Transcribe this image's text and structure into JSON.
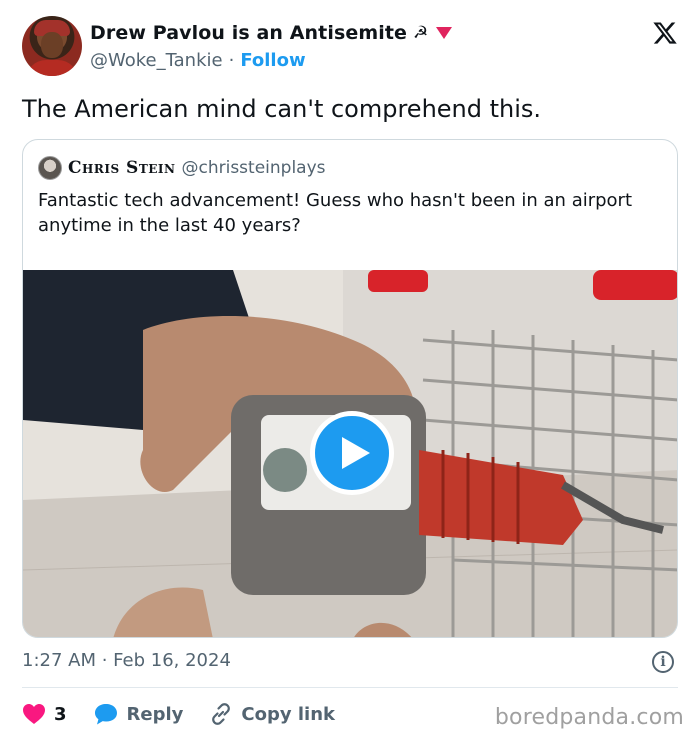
{
  "author": {
    "display_name": "Drew Pavlou is an Antisemite",
    "name_emoji": "☭",
    "handle": "@Woke_Tankie",
    "separator": "·",
    "follow_label": "Follow",
    "avatar_icon": "avatar"
  },
  "platform_icon": "x-logo-icon",
  "tweet": {
    "text": "The American mind can't comprehend this."
  },
  "quoted_tweet": {
    "display_name": "Chris Stein",
    "handle": "@chrissteinplays",
    "text": "Fantastic tech advancement! Guess who hasn't been in an airport anytime in the last 40 years?",
    "media_type": "video",
    "play_icon": "play-icon"
  },
  "meta": {
    "timestamp": "1:27 AM · Feb 16, 2024",
    "info_icon": "info-icon"
  },
  "actions": {
    "like_count": "3",
    "reply_label": "Reply",
    "copy_link_label": "Copy link"
  },
  "colors": {
    "accent": "#1d9bf0",
    "like": "#f91880",
    "secondary_text": "#536471"
  },
  "watermark": "boredpanda.com"
}
